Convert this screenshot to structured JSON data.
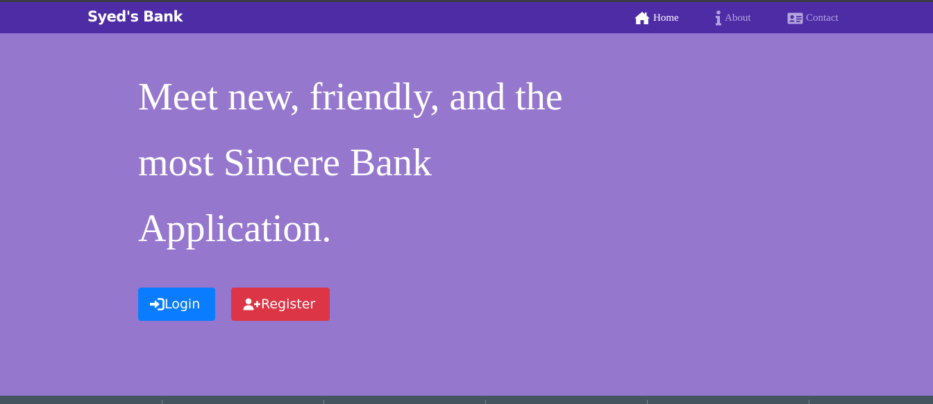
{
  "navbar": {
    "brand": "Syed's Bank",
    "links": [
      {
        "label": "Home",
        "icon": "home-icon",
        "active": true
      },
      {
        "label": "About",
        "icon": "info-icon",
        "active": false
      },
      {
        "label": "Contact",
        "icon": "contact-card-icon",
        "active": false
      }
    ]
  },
  "hero": {
    "title": "Meet new, friendly, and the most Sincere Bank Application."
  },
  "buttons": {
    "login": {
      "label": "Login",
      "icon": "sign-in-icon",
      "color": "#0a7cff"
    },
    "register": {
      "label": "Register",
      "icon": "user-plus-icon",
      "color": "#dc3545"
    }
  },
  "colors": {
    "navbar_bg": "#4e2ca6",
    "page_bg": "#9577cd"
  }
}
